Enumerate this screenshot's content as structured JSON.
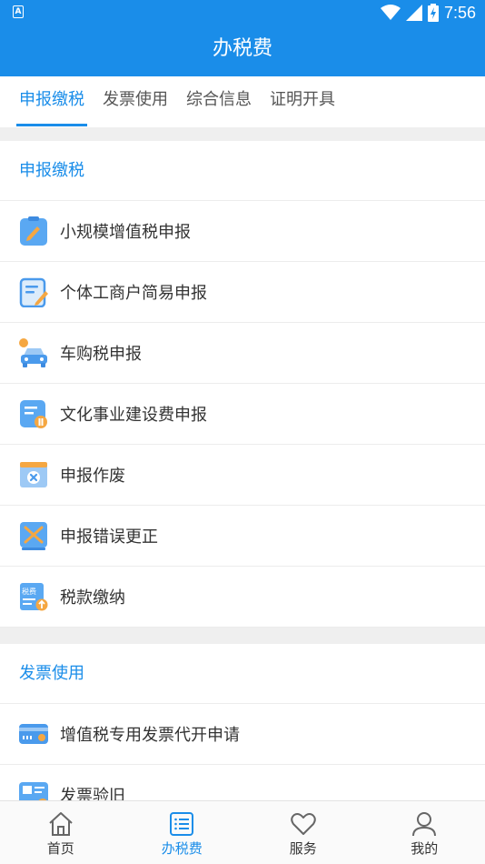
{
  "status_bar": {
    "time": "7:56",
    "notification_glyph": "A"
  },
  "header": {
    "title": "办税费"
  },
  "tabs": [
    {
      "label": "申报缴税",
      "active": true
    },
    {
      "label": "发票使用",
      "active": false
    },
    {
      "label": "综合信息",
      "active": false
    },
    {
      "label": "证明开具",
      "active": false
    }
  ],
  "sections": [
    {
      "title": "申报缴税",
      "items": [
        {
          "label": "小规模增值税申报",
          "icon": "clipboard-pen-icon"
        },
        {
          "label": "个体工商户简易申报",
          "icon": "form-edit-icon"
        },
        {
          "label": "车购税申报",
          "icon": "car-icon"
        },
        {
          "label": "文化事业建设费申报",
          "icon": "document-coin-icon"
        },
        {
          "label": "申报作废",
          "icon": "window-cancel-icon"
        },
        {
          "label": "申报错误更正",
          "icon": "cross-correct-icon"
        },
        {
          "label": "税款缴纳",
          "icon": "tax-payment-icon",
          "icon_text": "税费"
        }
      ]
    },
    {
      "title": "发票使用",
      "items": [
        {
          "label": "增值税专用发票代开申请",
          "icon": "invoice-card-icon"
        },
        {
          "label": "发票验旧",
          "icon": "invoice-verify-icon"
        }
      ]
    }
  ],
  "bottom_nav": [
    {
      "label": "首页",
      "icon": "home-icon",
      "active": false
    },
    {
      "label": "办税费",
      "icon": "list-icon",
      "active": true
    },
    {
      "label": "服务",
      "icon": "heart-icon",
      "active": false
    },
    {
      "label": "我的",
      "icon": "user-icon",
      "active": false
    }
  ],
  "colors": {
    "primary": "#1a8de9",
    "accent_orange": "#f5a742",
    "text": "#333333",
    "divider": "#ececec",
    "background": "#efefef"
  }
}
